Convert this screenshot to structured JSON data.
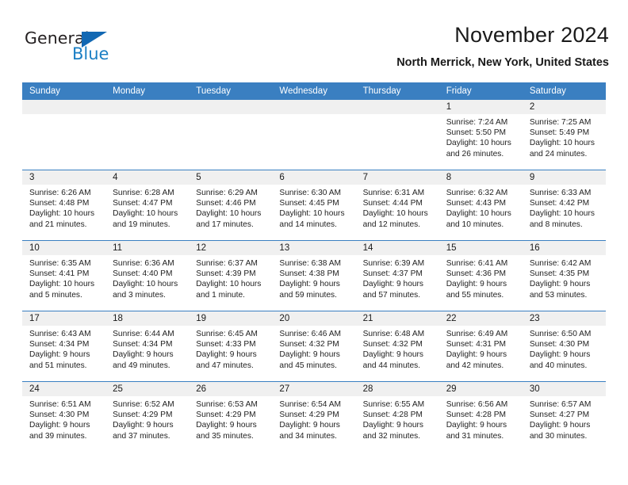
{
  "brand": {
    "name_part1": "General",
    "name_part2": "Blue",
    "triangle_color": "#1268b3",
    "blue_color": "#1b7fc4"
  },
  "header": {
    "month_title": "November 2024",
    "location": "North Merrick, New York, United States"
  },
  "theme": {
    "header_blue": "#3a7fc1",
    "date_band_gray": "#f0f0f0",
    "text_color": "#222222"
  },
  "calendar": {
    "weekday_headers": [
      "Sunday",
      "Monday",
      "Tuesday",
      "Wednesday",
      "Thursday",
      "Friday",
      "Saturday"
    ],
    "labels": {
      "sunrise": "Sunrise:",
      "sunset": "Sunset:",
      "daylight": "Daylight:"
    },
    "weeks": [
      [
        {
          "day": "",
          "empty": true
        },
        {
          "day": "",
          "empty": true
        },
        {
          "day": "",
          "empty": true
        },
        {
          "day": "",
          "empty": true
        },
        {
          "day": "",
          "empty": true
        },
        {
          "day": "1",
          "sunrise": "Sunrise: 7:24 AM",
          "sunset": "Sunset: 5:50 PM",
          "daylight": "Daylight: 10 hours and 26 minutes."
        },
        {
          "day": "2",
          "sunrise": "Sunrise: 7:25 AM",
          "sunset": "Sunset: 5:49 PM",
          "daylight": "Daylight: 10 hours and 24 minutes."
        }
      ],
      [
        {
          "day": "3",
          "sunrise": "Sunrise: 6:26 AM",
          "sunset": "Sunset: 4:48 PM",
          "daylight": "Daylight: 10 hours and 21 minutes."
        },
        {
          "day": "4",
          "sunrise": "Sunrise: 6:28 AM",
          "sunset": "Sunset: 4:47 PM",
          "daylight": "Daylight: 10 hours and 19 minutes."
        },
        {
          "day": "5",
          "sunrise": "Sunrise: 6:29 AM",
          "sunset": "Sunset: 4:46 PM",
          "daylight": "Daylight: 10 hours and 17 minutes."
        },
        {
          "day": "6",
          "sunrise": "Sunrise: 6:30 AM",
          "sunset": "Sunset: 4:45 PM",
          "daylight": "Daylight: 10 hours and 14 minutes."
        },
        {
          "day": "7",
          "sunrise": "Sunrise: 6:31 AM",
          "sunset": "Sunset: 4:44 PM",
          "daylight": "Daylight: 10 hours and 12 minutes."
        },
        {
          "day": "8",
          "sunrise": "Sunrise: 6:32 AM",
          "sunset": "Sunset: 4:43 PM",
          "daylight": "Daylight: 10 hours and 10 minutes."
        },
        {
          "day": "9",
          "sunrise": "Sunrise: 6:33 AM",
          "sunset": "Sunset: 4:42 PM",
          "daylight": "Daylight: 10 hours and 8 minutes."
        }
      ],
      [
        {
          "day": "10",
          "sunrise": "Sunrise: 6:35 AM",
          "sunset": "Sunset: 4:41 PM",
          "daylight": "Daylight: 10 hours and 5 minutes."
        },
        {
          "day": "11",
          "sunrise": "Sunrise: 6:36 AM",
          "sunset": "Sunset: 4:40 PM",
          "daylight": "Daylight: 10 hours and 3 minutes."
        },
        {
          "day": "12",
          "sunrise": "Sunrise: 6:37 AM",
          "sunset": "Sunset: 4:39 PM",
          "daylight": "Daylight: 10 hours and 1 minute."
        },
        {
          "day": "13",
          "sunrise": "Sunrise: 6:38 AM",
          "sunset": "Sunset: 4:38 PM",
          "daylight": "Daylight: 9 hours and 59 minutes."
        },
        {
          "day": "14",
          "sunrise": "Sunrise: 6:39 AM",
          "sunset": "Sunset: 4:37 PM",
          "daylight": "Daylight: 9 hours and 57 minutes."
        },
        {
          "day": "15",
          "sunrise": "Sunrise: 6:41 AM",
          "sunset": "Sunset: 4:36 PM",
          "daylight": "Daylight: 9 hours and 55 minutes."
        },
        {
          "day": "16",
          "sunrise": "Sunrise: 6:42 AM",
          "sunset": "Sunset: 4:35 PM",
          "daylight": "Daylight: 9 hours and 53 minutes."
        }
      ],
      [
        {
          "day": "17",
          "sunrise": "Sunrise: 6:43 AM",
          "sunset": "Sunset: 4:34 PM",
          "daylight": "Daylight: 9 hours and 51 minutes."
        },
        {
          "day": "18",
          "sunrise": "Sunrise: 6:44 AM",
          "sunset": "Sunset: 4:34 PM",
          "daylight": "Daylight: 9 hours and 49 minutes."
        },
        {
          "day": "19",
          "sunrise": "Sunrise: 6:45 AM",
          "sunset": "Sunset: 4:33 PM",
          "daylight": "Daylight: 9 hours and 47 minutes."
        },
        {
          "day": "20",
          "sunrise": "Sunrise: 6:46 AM",
          "sunset": "Sunset: 4:32 PM",
          "daylight": "Daylight: 9 hours and 45 minutes."
        },
        {
          "day": "21",
          "sunrise": "Sunrise: 6:48 AM",
          "sunset": "Sunset: 4:32 PM",
          "daylight": "Daylight: 9 hours and 44 minutes."
        },
        {
          "day": "22",
          "sunrise": "Sunrise: 6:49 AM",
          "sunset": "Sunset: 4:31 PM",
          "daylight": "Daylight: 9 hours and 42 minutes."
        },
        {
          "day": "23",
          "sunrise": "Sunrise: 6:50 AM",
          "sunset": "Sunset: 4:30 PM",
          "daylight": "Daylight: 9 hours and 40 minutes."
        }
      ],
      [
        {
          "day": "24",
          "sunrise": "Sunrise: 6:51 AM",
          "sunset": "Sunset: 4:30 PM",
          "daylight": "Daylight: 9 hours and 39 minutes."
        },
        {
          "day": "25",
          "sunrise": "Sunrise: 6:52 AM",
          "sunset": "Sunset: 4:29 PM",
          "daylight": "Daylight: 9 hours and 37 minutes."
        },
        {
          "day": "26",
          "sunrise": "Sunrise: 6:53 AM",
          "sunset": "Sunset: 4:29 PM",
          "daylight": "Daylight: 9 hours and 35 minutes."
        },
        {
          "day": "27",
          "sunrise": "Sunrise: 6:54 AM",
          "sunset": "Sunset: 4:29 PM",
          "daylight": "Daylight: 9 hours and 34 minutes."
        },
        {
          "day": "28",
          "sunrise": "Sunrise: 6:55 AM",
          "sunset": "Sunset: 4:28 PM",
          "daylight": "Daylight: 9 hours and 32 minutes."
        },
        {
          "day": "29",
          "sunrise": "Sunrise: 6:56 AM",
          "sunset": "Sunset: 4:28 PM",
          "daylight": "Daylight: 9 hours and 31 minutes."
        },
        {
          "day": "30",
          "sunrise": "Sunrise: 6:57 AM",
          "sunset": "Sunset: 4:27 PM",
          "daylight": "Daylight: 9 hours and 30 minutes."
        }
      ]
    ]
  }
}
